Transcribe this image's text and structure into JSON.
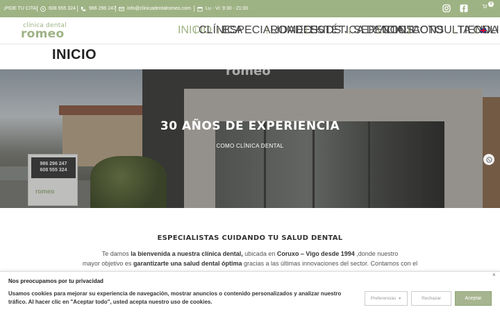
{
  "topbar": {
    "cta": "¡PIDE TU CITA!",
    "phone1": "608 555 324",
    "phone2": "986 296 247",
    "email": "info@clinicadentalromeo.com",
    "hours": "Lu - Vi: 9:30 - 21:00",
    "cart_count": "0",
    "icons": [
      "whatsapp-icon",
      "phone-icon",
      "mail-icon",
      "calendar-icon",
      "instagram-icon",
      "facebook-icon",
      "cart-icon"
    ]
  },
  "logo": {
    "line1": "clínica dental",
    "line2": "romeo"
  },
  "nav": {
    "items": [
      {
        "label": "INICIO"
      },
      {
        "label": "CLÍNICA"
      },
      {
        "label": "ESPECIALIDADES"
      },
      {
        "label": "ROMEO KIDS"
      },
      {
        "label": "ESTÉTICA DENTAL"
      },
      {
        "label": "SERVICIOS"
      },
      {
        "label": "CONTACTO"
      },
      {
        "label": "CONSULTA ONLINE"
      },
      {
        "label": "TIENDA"
      }
    ]
  },
  "page": {
    "title": "INICIO"
  },
  "hero": {
    "title": "30 AÑOS DE EXPERIENCIA",
    "subtitle": "COMO CLÍNICA DENTAL",
    "sign_phone1": "986 296 247",
    "sign_phone2": "608 555 324",
    "sign_brand": "romeo",
    "roof_logo": "romeo"
  },
  "content": {
    "title": "ESPECIALISTAS CUIDANDO TU SALUD DENTAL",
    "p1_a": "Te damos ",
    "p1_b": "la bienvenida a nuestra clínica dental,",
    "p1_c": " ubicada en ",
    "p1_d": "Coruxo – Vigo desde 1994",
    "p1_e": " ,donde nuestro",
    "p2_a": "mayor objetivo es ",
    "p2_b": "garantizarte una salud dental óptima",
    "p2_c": " gracias a las últimas innovaciones del sector. Contamos con el"
  },
  "cookie": {
    "title": "Nos preocupamos por tu privacidad",
    "text": "Usamos cookies para mejorar su experiencia de navegación, mostrar anuncios o contenido personalizados y analizar nuestro tráfico. Al hacer clic en \"Aceptar todo\", usted acepta nuestro uso de cookies.",
    "prefs": "Preferencias",
    "reject": "Rechazar",
    "accept": "Aceptar",
    "close": "×"
  },
  "colors": {
    "brand": "#9eb384",
    "accept": "#a6b58f"
  }
}
